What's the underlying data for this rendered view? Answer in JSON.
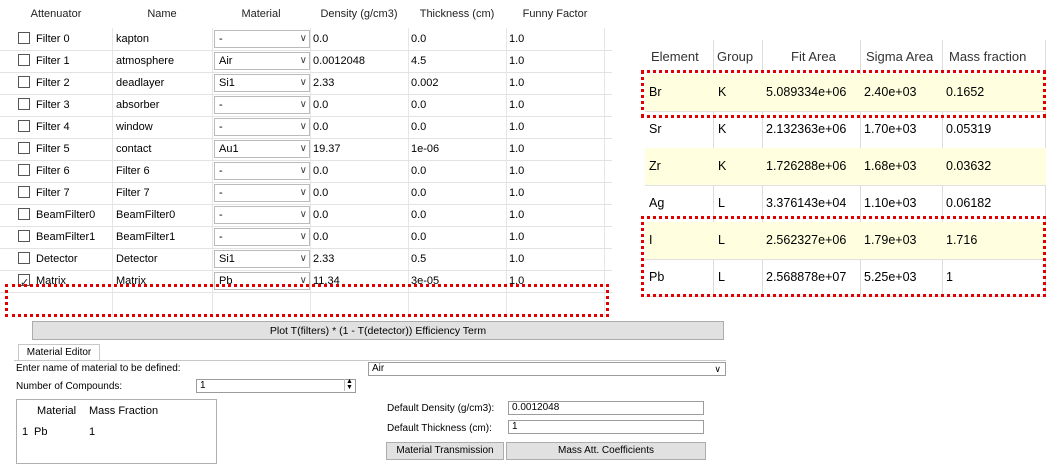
{
  "attenuators": {
    "columns": [
      "Attenuator",
      "Name",
      "Material",
      "Density (g/cm3)",
      "Thickness (cm)",
      "Funny Factor"
    ],
    "rows": [
      {
        "attenuator": "Filter 0",
        "checked": false,
        "name": "kapton",
        "material": "-",
        "density": "0.0",
        "thickness": "0.0",
        "factor": "1.0"
      },
      {
        "attenuator": "Filter 1",
        "checked": false,
        "name": "atmosphere",
        "material": "Air",
        "density": "0.0012048",
        "thickness": "4.5",
        "factor": "1.0"
      },
      {
        "attenuator": "Filter 2",
        "checked": false,
        "name": "deadlayer",
        "material": "Si1",
        "density": "2.33",
        "thickness": "0.002",
        "factor": "1.0"
      },
      {
        "attenuator": "Filter 3",
        "checked": false,
        "name": "absorber",
        "material": "-",
        "density": "0.0",
        "thickness": "0.0",
        "factor": "1.0"
      },
      {
        "attenuator": "Filter 4",
        "checked": false,
        "name": "window",
        "material": "-",
        "density": "0.0",
        "thickness": "0.0",
        "factor": "1.0"
      },
      {
        "attenuator": "Filter 5",
        "checked": false,
        "name": "contact",
        "material": "Au1",
        "density": "19.37",
        "thickness": "1e-06",
        "factor": "1.0"
      },
      {
        "attenuator": "Filter 6",
        "checked": false,
        "name": "Filter 6",
        "material": "-",
        "density": "0.0",
        "thickness": "0.0",
        "factor": "1.0"
      },
      {
        "attenuator": "Filter 7",
        "checked": false,
        "name": "Filter 7",
        "material": "-",
        "density": "0.0",
        "thickness": "0.0",
        "factor": "1.0"
      },
      {
        "attenuator": "BeamFilter0",
        "checked": false,
        "name": "BeamFilter0",
        "material": "-",
        "density": "0.0",
        "thickness": "0.0",
        "factor": "1.0"
      },
      {
        "attenuator": "BeamFilter1",
        "checked": false,
        "name": "BeamFilter1",
        "material": "-",
        "density": "0.0",
        "thickness": "0.0",
        "factor": "1.0"
      },
      {
        "attenuator": "Detector",
        "checked": false,
        "name": "Detector",
        "material": "Si1",
        "density": "2.33",
        "thickness": "0.5",
        "factor": "1.0"
      },
      {
        "attenuator": "Matrix",
        "checked": true,
        "name": "Matrix",
        "material": "Pb",
        "density": "11.34",
        "thickness": "3e-05",
        "factor": "1.0"
      }
    ]
  },
  "plot_button": "Plot T(filters) * (1 - T(detector)) Efficiency Term",
  "material_editor": {
    "tab_label": "Material Editor",
    "name_prompt": "Enter name of material to be defined:",
    "name_value": "Air",
    "compounds_label": "Number  of  Compounds:",
    "compounds_value": "1",
    "compound_table": {
      "columns": [
        "Material",
        "Mass Fraction"
      ],
      "rows": [
        {
          "index": "1",
          "material": "Pb",
          "fraction": "1"
        }
      ]
    },
    "density_label": "Default Density (g/cm3):",
    "density_value": "0.0012048",
    "thickness_label": "Default  Thickness  (cm):",
    "thickness_value": "1",
    "transmission_button": "Material Transmission",
    "mass_att_button": "Mass Att. Coefficients"
  },
  "results": {
    "columns": [
      "Element",
      "Group",
      "Fit Area",
      "Sigma Area",
      "Mass fraction"
    ],
    "rows": [
      {
        "element": "Br",
        "group": "K",
        "fit_area": "5.089334e+06",
        "sigma_area": "2.40e+03",
        "mass_fraction": "0.1652"
      },
      {
        "element": "Sr",
        "group": "K",
        "fit_area": "2.132363e+06",
        "sigma_area": "1.70e+03",
        "mass_fraction": "0.05319"
      },
      {
        "element": "Zr",
        "group": "K",
        "fit_area": "1.726288e+06",
        "sigma_area": "1.68e+03",
        "mass_fraction": "0.03632"
      },
      {
        "element": "Ag",
        "group": "L",
        "fit_area": "3.376143e+04",
        "sigma_area": "1.10e+03",
        "mass_fraction": "0.06182"
      },
      {
        "element": "I",
        "group": "L",
        "fit_area": "2.562327e+06",
        "sigma_area": "1.79e+03",
        "mass_fraction": "1.716"
      },
      {
        "element": "Pb",
        "group": "L",
        "fit_area": "2.568878e+07",
        "sigma_area": "5.25e+03",
        "mass_fraction": "1"
      }
    ]
  },
  "icons": {
    "dropdown": "chevron-down-icon",
    "spin": "spin-arrows-icon",
    "check": "check-icon"
  },
  "colors": {
    "highlight": "#e00000",
    "alt_row": "#ffffe0"
  }
}
